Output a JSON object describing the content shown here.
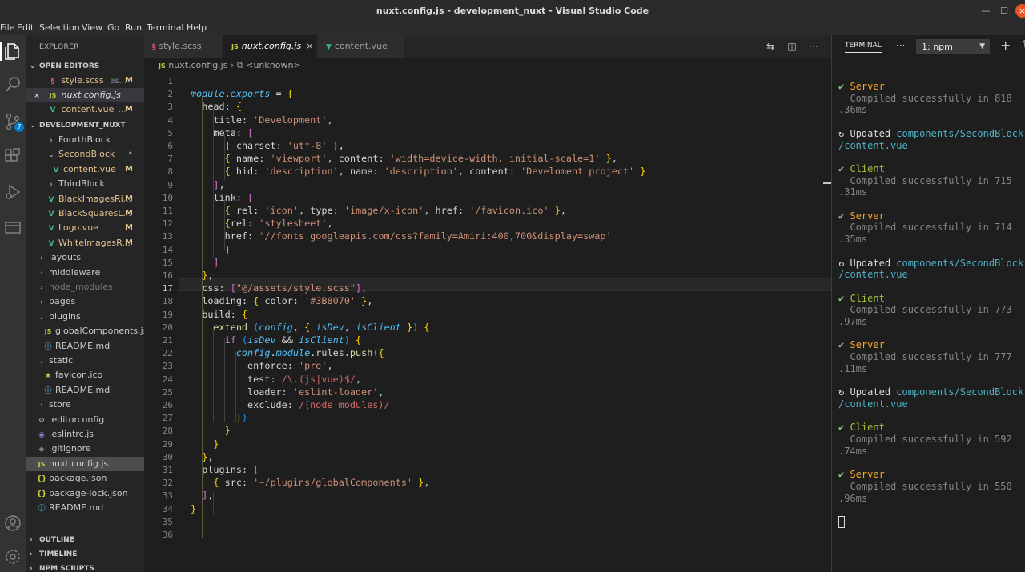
{
  "window": {
    "title": "nuxt.config.js - development_nuxt - Visual Studio Code"
  },
  "menu": [
    "File",
    "Edit",
    "Selection",
    "View",
    "Go",
    "Run",
    "Terminal",
    "Help"
  ],
  "activitybar": {
    "scm_badge": "7"
  },
  "sidebar": {
    "header": "EXPLORER",
    "open_editors_label": "OPEN EDITORS",
    "open_editors": [
      {
        "name": "style.scss",
        "suffix": "as...",
        "status": "M",
        "icon": "scss-icon"
      },
      {
        "name": "nuxt.config.js",
        "suffix": "",
        "status": "",
        "icon": "js-icon",
        "close": "×"
      },
      {
        "name": "content.vue",
        "suffix": "...",
        "status": "M",
        "icon": "vue-icon"
      }
    ],
    "project_label": "DEVELOPMENT_NUXT",
    "tree": [
      {
        "name": "FourthBlock",
        "chevron": "›",
        "status": ""
      },
      {
        "name": "SecondBlock",
        "chevron": "⌄",
        "status": "•"
      },
      {
        "name": "content.vue",
        "chevron": "",
        "status": "M"
      },
      {
        "name": "ThirdBlock",
        "chevron": "›",
        "status": ""
      },
      {
        "name": "BlackImagesRi...",
        "chevron": "",
        "status": "M"
      },
      {
        "name": "BlackSquaresL...",
        "chevron": "",
        "status": "M"
      },
      {
        "name": "Logo.vue",
        "chevron": "",
        "status": "M"
      },
      {
        "name": "WhiteImagesR...",
        "chevron": "",
        "status": "M"
      },
      {
        "name": "layouts",
        "chevron": "›",
        "status": ""
      },
      {
        "name": "middleware",
        "chevron": "›",
        "status": ""
      },
      {
        "name": "node_modules",
        "chevron": "›",
        "status": ""
      },
      {
        "name": "pages",
        "chevron": "›",
        "status": ""
      },
      {
        "name": "plugins",
        "chevron": "⌄",
        "status": ""
      },
      {
        "name": "globalComponents.js",
        "chevron": "",
        "status": ""
      },
      {
        "name": "README.md",
        "chevron": "",
        "status": ""
      },
      {
        "name": "static",
        "chevron": "⌄",
        "status": ""
      },
      {
        "name": "favicon.ico",
        "chevron": "",
        "status": ""
      },
      {
        "name": "README.md",
        "chevron": "",
        "status": ""
      },
      {
        "name": "store",
        "chevron": "›",
        "status": ""
      },
      {
        "name": ".editorconfig",
        "chevron": "",
        "status": ""
      },
      {
        "name": ".eslintrc.js",
        "chevron": "",
        "status": ""
      },
      {
        "name": ".gitignore",
        "chevron": "",
        "status": ""
      },
      {
        "name": "nuxt.config.js",
        "chevron": "",
        "status": ""
      },
      {
        "name": "package.json",
        "chevron": "",
        "status": ""
      },
      {
        "name": "package-lock.json",
        "chevron": "",
        "status": ""
      },
      {
        "name": "README.md",
        "chevron": "",
        "status": ""
      }
    ],
    "outline_label": "OUTLINE",
    "timeline_label": "TIMELINE",
    "npm_label": "NPM SCRIPTS"
  },
  "tabs": [
    {
      "label": "style.scss",
      "icon": "scss-icon"
    },
    {
      "label": "nuxt.config.js",
      "icon": "js-icon",
      "close": "×"
    },
    {
      "label": "content.vue",
      "icon": "vue-icon"
    }
  ],
  "breadcrumb": {
    "file": "nuxt.config.js",
    "symbol": "<unknown>"
  },
  "editor": {
    "current_line": 17,
    "lines": [
      "",
      "module.exports = {",
      "  head: {",
      "    title: 'Development',",
      "    meta: [",
      "      { charset: 'utf-8' },",
      "      { name: 'viewport', content: 'width=device-width, initial-scale=1' },",
      "      { hid: 'description', name: 'description', content: 'Develoment project' }",
      "    ],",
      "    link: [",
      "      { rel: 'icon', type: 'image/x-icon', href: '/favicon.ico' },",
      "      {rel: 'stylesheet',",
      "      href: '//fonts.googleapis.com/css?family=Amiri:400,700&display=swap'",
      "      }",
      "    ]",
      "  },",
      "  css: [\"@/assets/style.scss\"],",
      "  loading: { color: '#3B8070' },",
      "  build: {",
      "    extend (config, { isDev, isClient }) {",
      "      if (isDev && isClient) {",
      "        config.module.rules.push({",
      "          enforce: 'pre',",
      "          test: /\\.(js|vue)$/,",
      "          loader: 'eslint-loader',",
      "          exclude: /(node_modules)/",
      "        })",
      "      }",
      "    }",
      "  },",
      "  plugins: [",
      "    { src: '~/plugins/globalComponents' },",
      "  ],",
      "}",
      "",
      ""
    ]
  },
  "terminal": {
    "tab_label": "TERMINAL",
    "more": "···",
    "selected_shell": "1: npm",
    "lines": [
      {
        "kind": "head",
        "mark": "✔",
        "text": "Server",
        "color": "srv"
      },
      {
        "kind": "dim",
        "text": "  Compiled successfully in 818"
      },
      {
        "kind": "dim",
        "text": ".36ms"
      },
      {
        "kind": "gap"
      },
      {
        "kind": "upd",
        "mark": "↻",
        "text": "Updated ",
        "path": "components/SecondBlock"
      },
      {
        "kind": "path",
        "text": "/content.vue"
      },
      {
        "kind": "gap"
      },
      {
        "kind": "head",
        "mark": "✔",
        "text": "Client",
        "color": "cli"
      },
      {
        "kind": "dim",
        "text": "  Compiled successfully in 715"
      },
      {
        "kind": "dim",
        "text": ".31ms"
      },
      {
        "kind": "gap"
      },
      {
        "kind": "head",
        "mark": "✔",
        "text": "Server",
        "color": "srv"
      },
      {
        "kind": "dim",
        "text": "  Compiled successfully in 714"
      },
      {
        "kind": "dim",
        "text": ".35ms"
      },
      {
        "kind": "gap"
      },
      {
        "kind": "upd",
        "mark": "↻",
        "text": "Updated ",
        "path": "components/SecondBlock"
      },
      {
        "kind": "path",
        "text": "/content.vue"
      },
      {
        "kind": "gap"
      },
      {
        "kind": "head",
        "mark": "✔",
        "text": "Client",
        "color": "cli"
      },
      {
        "kind": "dim",
        "text": "  Compiled successfully in 773"
      },
      {
        "kind": "dim",
        "text": ".97ms"
      },
      {
        "kind": "gap"
      },
      {
        "kind": "head",
        "mark": "✔",
        "text": "Server",
        "color": "srv"
      },
      {
        "kind": "dim",
        "text": "  Compiled successfully in 777"
      },
      {
        "kind": "dim",
        "text": ".11ms"
      },
      {
        "kind": "gap"
      },
      {
        "kind": "upd",
        "mark": "↻",
        "text": "Updated ",
        "path": "components/SecondBlock"
      },
      {
        "kind": "path",
        "text": "/content.vue"
      },
      {
        "kind": "gap"
      },
      {
        "kind": "head",
        "mark": "✔",
        "text": "Client",
        "color": "cli"
      },
      {
        "kind": "dim",
        "text": "  Compiled successfully in 592"
      },
      {
        "kind": "dim",
        "text": ".74ms"
      },
      {
        "kind": "gap"
      },
      {
        "kind": "head",
        "mark": "✔",
        "text": "Server",
        "color": "srv"
      },
      {
        "kind": "dim",
        "text": "  Compiled successfully in 550"
      },
      {
        "kind": "dim",
        "text": ".96ms"
      }
    ]
  },
  "colors": {
    "accent": "#007acc",
    "editor_bg": "#1e1e1e",
    "sidebar_bg": "#252526",
    "modified": "#e2c08d",
    "vue_green": "#41b883"
  }
}
